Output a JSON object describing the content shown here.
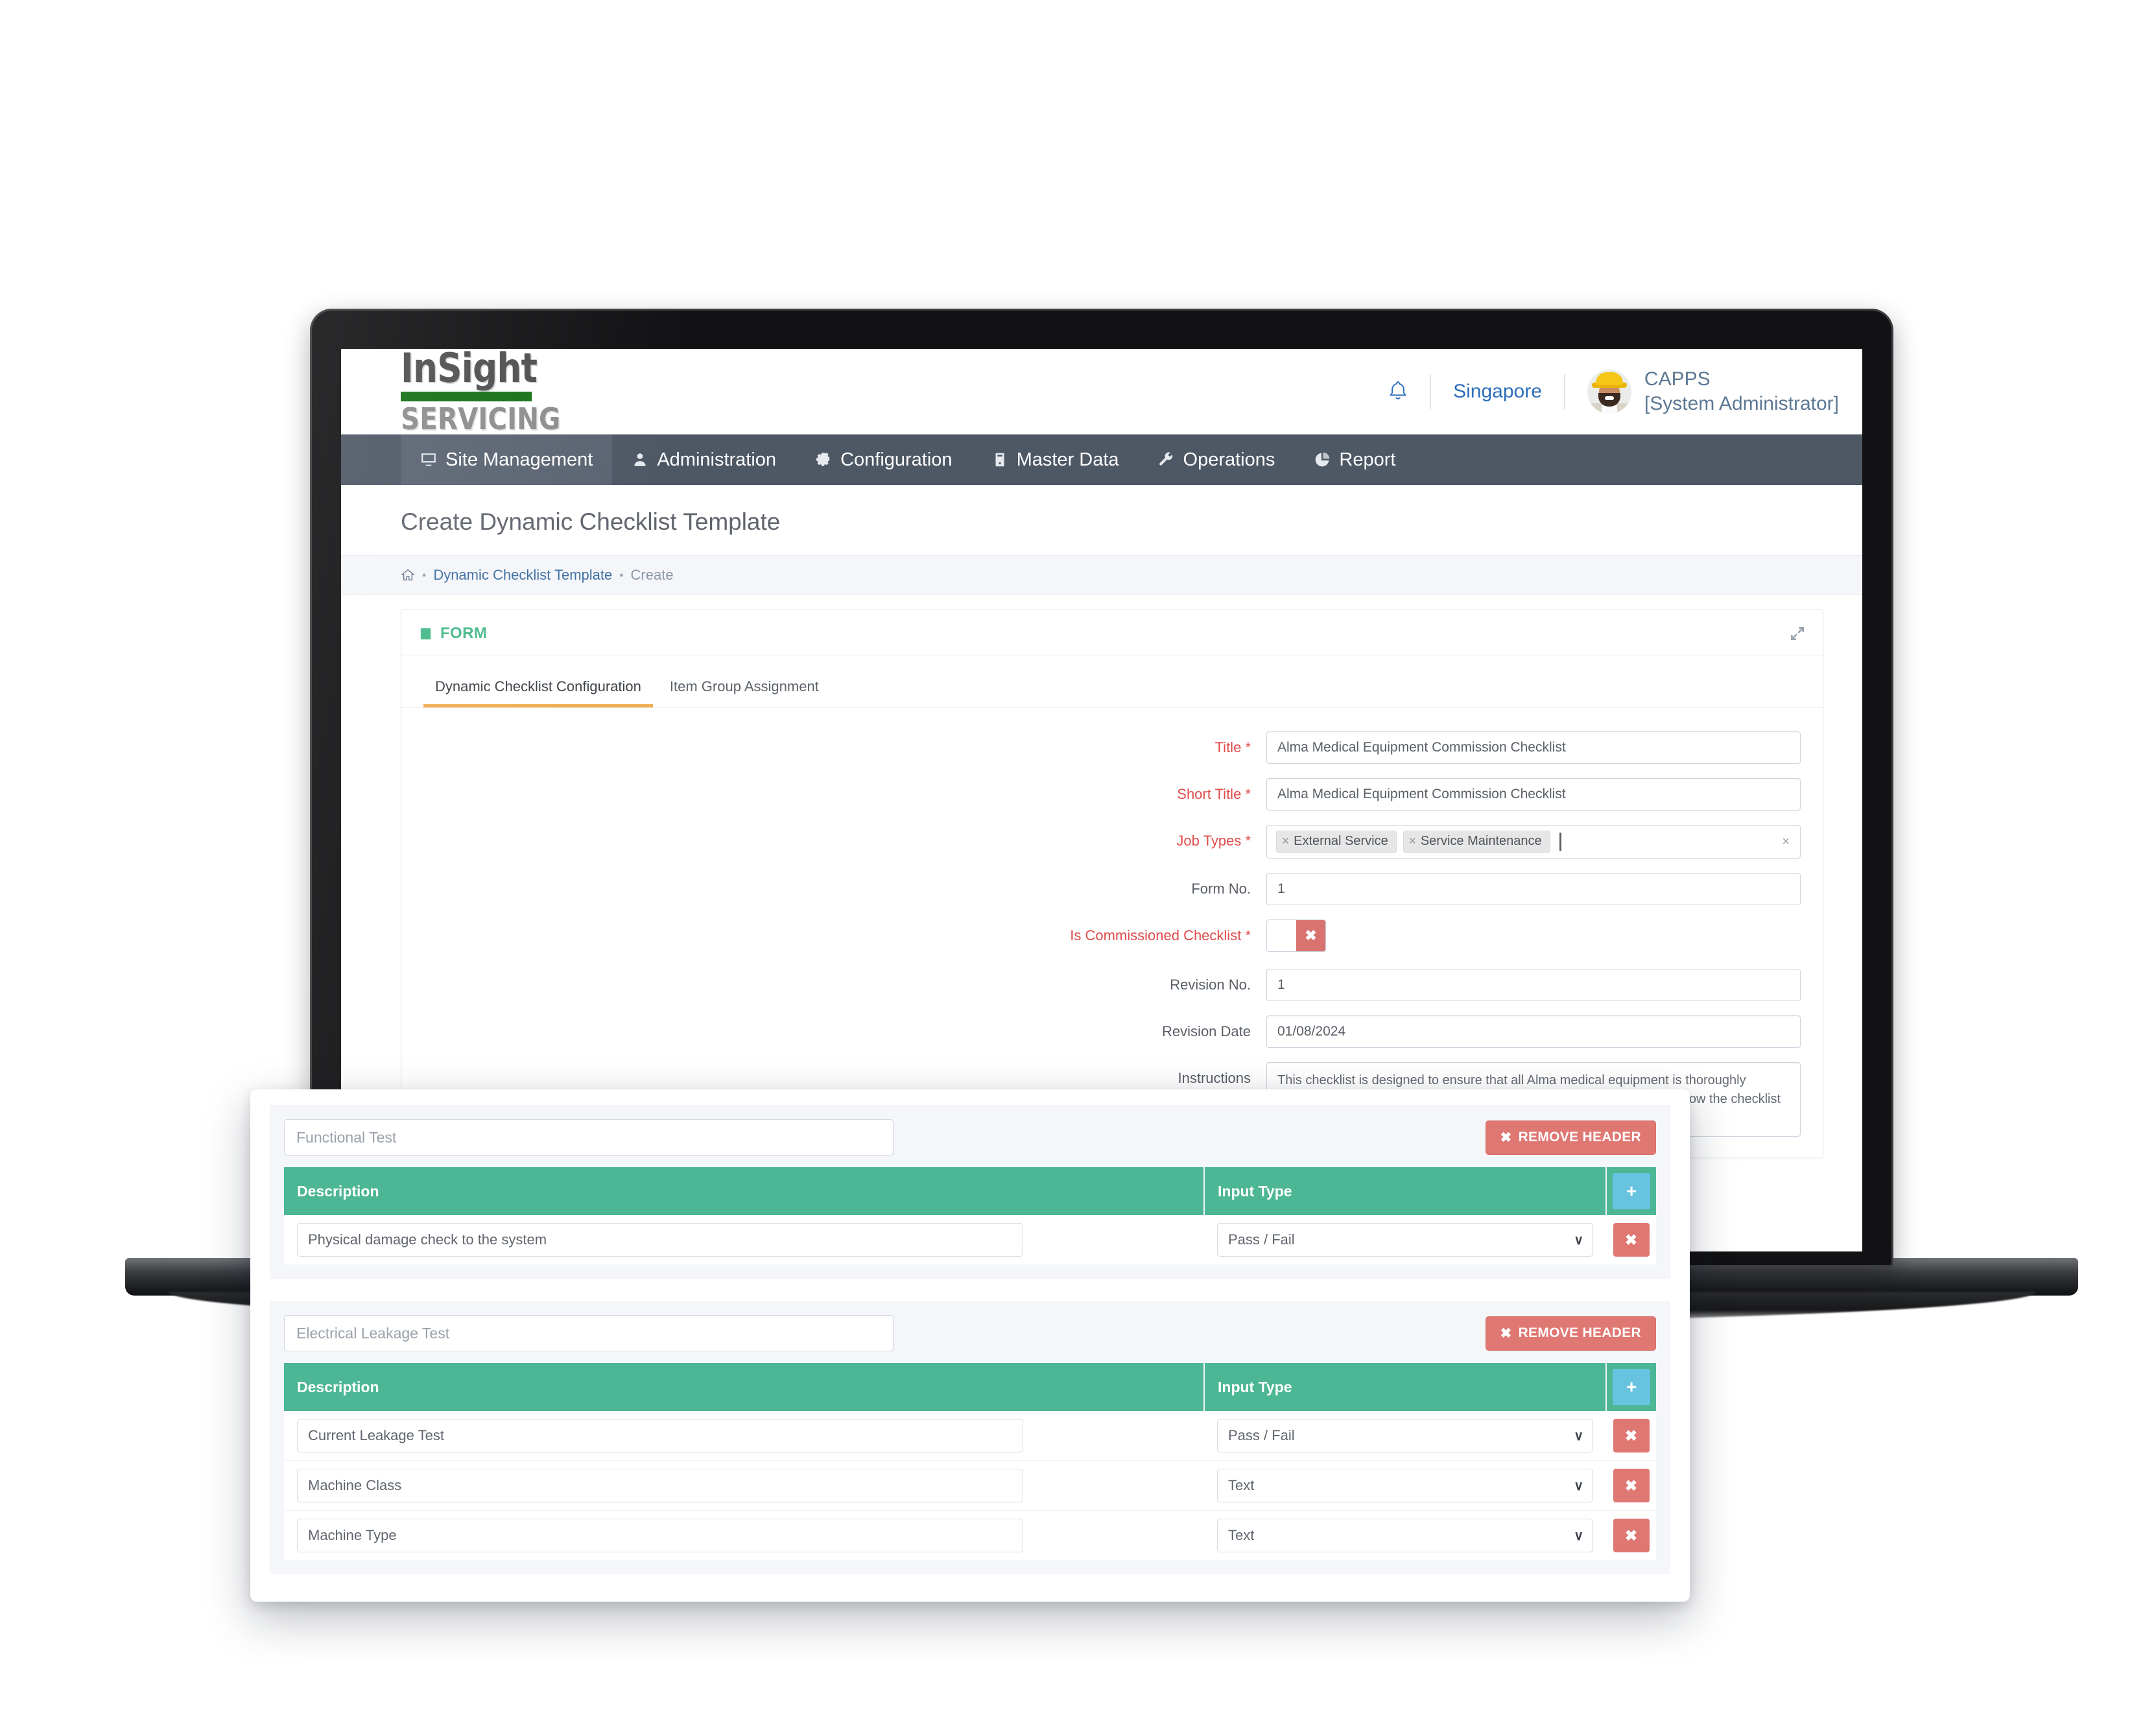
{
  "header": {
    "logo_top": "InSight",
    "logo_bottom": "SERVICING",
    "bell_icon": "bell-icon",
    "site": "Singapore",
    "user_name": "CAPPS",
    "user_role": "[System Administrator]"
  },
  "nav": {
    "items": [
      {
        "label": "Site Management",
        "icon": "desktop-icon"
      },
      {
        "label": "Administration",
        "icon": "user-icon"
      },
      {
        "label": "Configuration",
        "icon": "gear-icon"
      },
      {
        "label": "Master Data",
        "icon": "server-icon"
      },
      {
        "label": "Operations",
        "icon": "wrench-icon"
      },
      {
        "label": "Report",
        "icon": "pie-chart-icon"
      }
    ]
  },
  "page": {
    "title": "Create Dynamic Checklist Template",
    "breadcrumb": {
      "home_icon": "home-icon",
      "link": "Dynamic Checklist Template",
      "current": "Create",
      "separator": "•"
    }
  },
  "card": {
    "title": "FORM",
    "title_icon": "book-icon",
    "expand_icon": "expand-icon",
    "tabs": [
      {
        "label": "Dynamic Checklist Configuration",
        "active": true
      },
      {
        "label": "Item Group Assignment",
        "active": false
      }
    ]
  },
  "form": {
    "fields": [
      {
        "label": "Title",
        "required": true,
        "value": "Alma Medical Equipment Commission Checklist"
      },
      {
        "label": "Short Title",
        "required": true,
        "value": "Alma Medical Equipment Commission Checklist"
      },
      {
        "label": "Job Types",
        "required": true,
        "tags": [
          "External Service",
          "Service Maintenance"
        ]
      },
      {
        "label": "Form No.",
        "required": false,
        "value": "1"
      },
      {
        "label": "Is Commissioned Checklist",
        "required": true,
        "toggle": "off",
        "toggle_glyph": "✖"
      },
      {
        "label": "Revision No.",
        "required": false,
        "value": "1"
      },
      {
        "label": "Revision Date",
        "required": false,
        "value": "01/08/2024"
      },
      {
        "label": "Instructions",
        "required": false,
        "value": "This checklist is designed to ensure that all Alma medical equipment is thoroughly inspected and maintained according to standard procedures. Please follow the checklist and provide your responses accordingly."
      }
    ],
    "title_label": "Title",
    "title_value": "Alma Medical Equipment Commission Checklist",
    "short_title_label": "Short Title",
    "short_title_value": "Alma Medical Equipment Commission Checklist",
    "job_types_label": "Job Types",
    "job_tag_1": "External Service",
    "job_tag_2": "Service Maintenance",
    "tag_remove_glyph": "×",
    "multi_clear_glyph": "×",
    "form_no_label": "Form No.",
    "form_no_value": "1",
    "commissioned_label": "Is Commissioned Checklist",
    "commissioned_glyph": "✖",
    "revision_no_label": "Revision No.",
    "revision_no_value": "1",
    "revision_date_label": "Revision Date",
    "revision_date_value": "01/08/2024",
    "instructions_label": "Instructions",
    "instructions_value": "This checklist is designed to ensure that all Alma medical equipment is thoroughly inspected and maintained according to standard procedures. Please follow the checklist and provide your responses accordingly.",
    "required_star": "*"
  },
  "overlay": {
    "remove_header_label": "REMOVE HEADER",
    "remove_header_glyph": "✖",
    "add_glyph": "+",
    "delete_glyph": "✖",
    "chevron_glyph": "∨",
    "columns": {
      "description": "Description",
      "input_type": "Input Type"
    },
    "sections": [
      {
        "header_placeholder": "Functional Test",
        "rows": [
          {
            "description": "Physical damage check to the system",
            "input_type": "Pass / Fail"
          }
        ]
      },
      {
        "header_placeholder": "Electrical Leakage Test",
        "rows": [
          {
            "description": "Current Leakage Test",
            "input_type": "Pass / Fail"
          },
          {
            "description": "Machine Class",
            "input_type": "Text"
          },
          {
            "description": "Machine Type",
            "input_type": "Text"
          }
        ]
      }
    ],
    "s1_header": "Functional Test",
    "s1_r1_desc": "Physical damage check to the system",
    "s1_r1_type": "Pass / Fail",
    "s2_header": "Electrical Leakage Test",
    "s2_r1_desc": "Current Leakage Test",
    "s2_r1_type": "Pass / Fail",
    "s2_r2_desc": "Machine Class",
    "s2_r2_type": "Text",
    "s2_r3_desc": "Machine Type",
    "s2_r3_type": "Text"
  },
  "colors": {
    "nav_bg": "#4e5764",
    "table_header_green": "#4db695",
    "accent_green": "#46b98a",
    "danger_red": "#df7772",
    "add_blue": "#67c3e0",
    "tab_active": "#f0ad4e",
    "link_blue": "#3e6ea3",
    "logo_green": "#147014"
  }
}
